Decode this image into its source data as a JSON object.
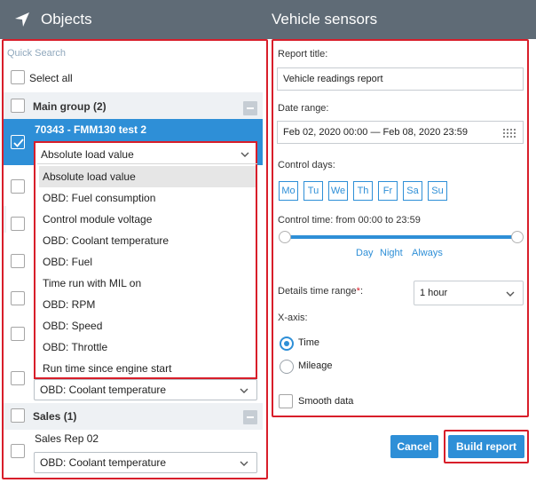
{
  "left_header": {
    "title": "Objects",
    "icon": "navigation-arrow-icon"
  },
  "right_header": {
    "title": "Vehicle sensors"
  },
  "objects": {
    "quick_search_placeholder": "Quick Search",
    "select_all": "Select all",
    "groups": [
      {
        "name": "Main group (2)"
      },
      {
        "name": "Sales (1)"
      }
    ],
    "selected_unit": {
      "name": "70343 - FMM130 test 2",
      "sensor": "Absolute load value"
    },
    "row_sensor_1": "OBD: Coolant temperature",
    "unit_sales_rep": {
      "name": "Sales Rep 02",
      "sensor": "OBD: Coolant temperature"
    },
    "dropdown_options": [
      "Absolute load value",
      "OBD: Fuel consumption",
      "Control module voltage",
      "OBD: Coolant temperature",
      "OBD: Fuel",
      "Time run with MIL on",
      "OBD: RPM",
      "OBD: Speed",
      "OBD: Throttle",
      "Run time since engine start"
    ]
  },
  "report": {
    "title_label": "Report title:",
    "title_value": "Vehicle readings report",
    "date_range_label": "Date range:",
    "date_range_value": "Feb 02, 2020 00:00 — Feb 08, 2020 23:59",
    "control_days_label": "Control days:",
    "days": [
      "Mo",
      "Tu",
      "We",
      "Th",
      "Fr",
      "Sa",
      "Su"
    ],
    "control_time_label": "Control time: from 00:00 to 23:59",
    "time_presets": [
      "Day",
      "Night",
      "Always"
    ],
    "details_label": "Details time range",
    "required_mark": "*",
    "details_colon": ":",
    "details_value": "1 hour",
    "xaxis_label": "X-axis:",
    "xaxis_options": [
      "Time",
      "Mileage"
    ],
    "xaxis_selected": "Time",
    "smooth_label": "Smooth data"
  },
  "buttons": {
    "cancel": "Cancel",
    "build": "Build report"
  },
  "colors": {
    "header": "#5f6b76",
    "accent": "#2e8fd7",
    "highlight_frame": "#d81e2a"
  }
}
